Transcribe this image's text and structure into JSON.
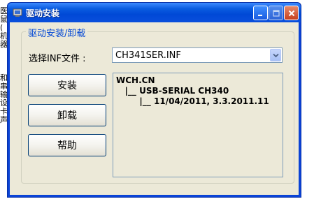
{
  "window": {
    "title": "驱动安装"
  },
  "background_fragments": [
    "医",
    "鼠",
    "(",
    "机",
    "器",
    "和",
    "串",
    "输",
    "设",
    "卡",
    "声"
  ],
  "group": {
    "legend": "驱动安装/卸载"
  },
  "inf_selector": {
    "label": "选择INF文件 :",
    "selected": "CH341SER.INF"
  },
  "buttons": {
    "install": "安装",
    "uninstall": "卸载",
    "help": "帮助"
  },
  "info": {
    "lines": [
      "WCH.CN",
      "   |__ USB-SERIAL CH340",
      "        |__ 11/04/2011, 3.3.2011.11"
    ]
  },
  "icons": {
    "app": "driver-install-icon",
    "minimize": "minimize-icon",
    "maximize": "maximize-icon",
    "close": "close-icon",
    "dropdown": "chevron-down-icon"
  },
  "colors": {
    "titlebar": "#0a5ce0",
    "legend": "#0046d5",
    "client": "#ece9d8"
  }
}
